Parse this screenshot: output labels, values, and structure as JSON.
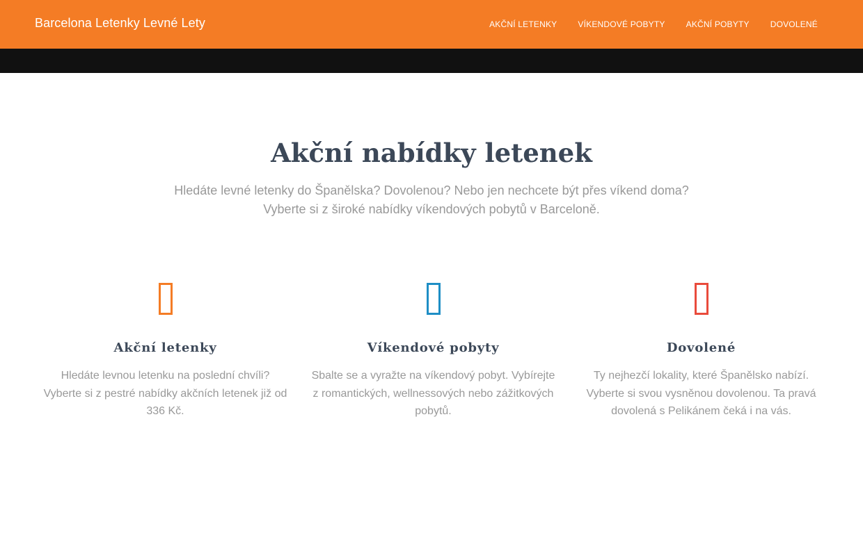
{
  "header": {
    "brand": "Barcelona Letenky Levné Lety",
    "background": "#f47c25",
    "nav": [
      {
        "label": "Akční letenky"
      },
      {
        "label": "Víkendové pobyty"
      },
      {
        "label": "Akční pobyty"
      },
      {
        "label": "Dovolené"
      }
    ]
  },
  "intro": {
    "title": "Akční nabídky letenek",
    "subtitle_line1": "Hledáte levné letenky do Španělska? Dovolenou? Nebo jen nechcete být přes víkend doma?",
    "subtitle_line2": "Vyberte si z široké nabídky víkendových pobytů v Barceloně."
  },
  "features": [
    {
      "icon": "airplane-icon",
      "icon_color": "#f47c25",
      "title": "Akční letenky",
      "text": "Hledáte levnou letenku na poslední chvíli? Vyberte si z pestré nabídky akčních letenek již od 336 Kč."
    },
    {
      "icon": "calendar-icon",
      "icon_color": "#1e8ec5",
      "title": "Víkendové pobyty",
      "text": "Sbalte se a vyražte na víkendový pobyt. Vybírejte z romantických, wellnessových nebo zážitkových pobytů."
    },
    {
      "icon": "sun-icon",
      "icon_color": "#e94b3c",
      "title": "Dovolené",
      "text": "Ty nejhezčí lokality, které Španělsko nabízí. Vyberte si svou vysněnou dovolenou. Ta pravá dovolená s Pelikánem čeká i na vás."
    }
  ]
}
